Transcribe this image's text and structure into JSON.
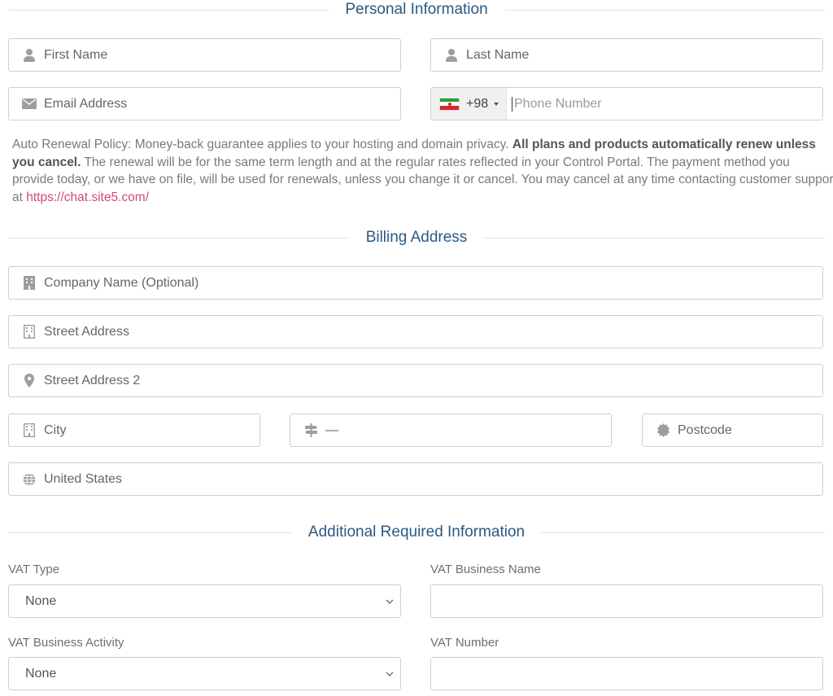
{
  "sections": {
    "personal": "Personal Information",
    "billing": "Billing Address",
    "additional": "Additional Required Information"
  },
  "personal": {
    "first_name_placeholder": "First Name",
    "last_name_placeholder": "Last Name",
    "email_placeholder": "Email Address",
    "phone_dial_code": "+98",
    "phone_country_flag": "iran-flag",
    "phone_placeholder": "Phone Number"
  },
  "policy": {
    "part1": "Auto Renewal Policy: Money-back guarantee applies to your hosting and domain privacy. ",
    "bold_part1": "All plans and products automatically renew unless",
    "bold_part2": "you cancel.",
    "part2": " The renewal will be for the same term length and at the regular rates reflected in your Control Portal. The payment method you",
    "part3": "provide today, or we have on file, will be used for renewals, unless you change it or cancel. You may cancel at any time contacting customer support",
    "part4": "at ",
    "link": "https://chat.site5.com/"
  },
  "billing": {
    "company_placeholder": "Company Name (Optional)",
    "street_placeholder": "Street Address",
    "street2_placeholder": "Street Address 2",
    "city_placeholder": "City",
    "state_value": "—",
    "postcode_placeholder": "Postcode",
    "country_value": "United States"
  },
  "additional": {
    "vat_type_label": "VAT Type",
    "vat_type_value": "None",
    "vat_business_name_label": "VAT Business Name",
    "vat_business_name_value": "",
    "vat_business_activity_label": "VAT Business Activity",
    "vat_business_activity_value": "None",
    "vat_number_label": "VAT Number",
    "vat_number_value": ""
  },
  "colors": {
    "heading": "#2a5a82",
    "link": "#d1477a",
    "border": "#cfcfcf",
    "phone_prefix_bg": "#f0f0f0"
  },
  "icons": [
    "user-icon",
    "envelope-icon",
    "building-icon",
    "map-marker-icon",
    "signpost-icon",
    "certificate-icon",
    "globe-icon",
    "chevron-down-icon"
  ]
}
